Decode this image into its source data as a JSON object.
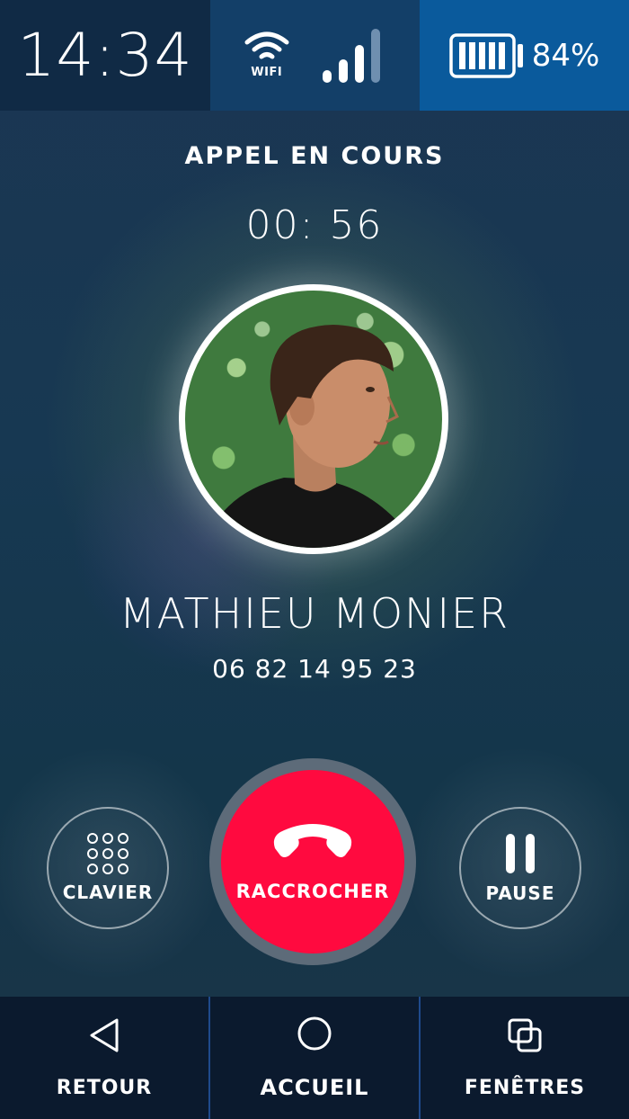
{
  "status_bar": {
    "time": "14:34",
    "wifi_label": "WIFI",
    "battery_percent": "84%",
    "battery_level": 0.84,
    "signal_bars_active": 3,
    "signal_bars_total": 4
  },
  "call": {
    "status": "APPEL EN COURS",
    "timer": "00: 56"
  },
  "contact": {
    "name": "MATHIEU MONIER",
    "number": "06 82 14 95 23"
  },
  "actions": {
    "keypad_label": "CLAVIER",
    "hangup_label": "RACCROCHER",
    "pause_label": "PAUSE"
  },
  "nav": {
    "back_label": "RETOUR",
    "home_label": "ACCUEIL",
    "windows_label": "FENÊTRES"
  },
  "colors": {
    "hangup": "#ff0a3f",
    "statusbar_time_bg": "#102a45",
    "statusbar_net_bg": "#133f68",
    "statusbar_batt_bg": "#0a5a9c",
    "navbar_bg": "#0b1a2e"
  }
}
